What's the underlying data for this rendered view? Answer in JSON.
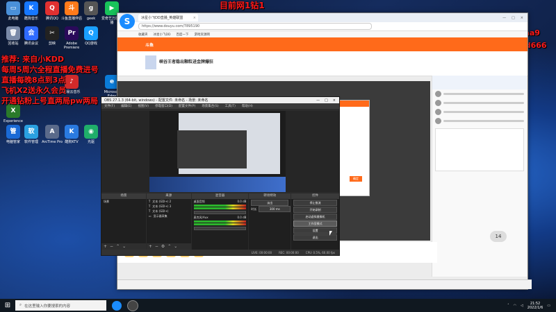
{
  "overlay": {
    "top_text": "目前网1钻1",
    "right_line1": "千分PW V jxyaa9",
    "right_line2": "本人xiaofeidd666",
    "left_lines": [
      "推荐: 来自小KDD",
      "每周5周六全程直播免费进号",
      "直播每晚8点到3点",
      "飞机X2送永久会员",
      "开通钻粉上号直两局pw两局"
    ]
  },
  "desktop_icons": [
    {
      "label": "此电脑",
      "color": "#4a90d9",
      "glyph": "▭"
    },
    {
      "label": "酷狗音乐",
      "color": "#1677ff",
      "glyph": "K"
    },
    {
      "label": "腾讯QQ",
      "color": "#e03030",
      "glyph": "Q"
    },
    {
      "label": "斗鱼直播伴侣",
      "color": "#ff7a1a",
      "glyph": "斗"
    },
    {
      "label": "geek",
      "color": "#555555",
      "glyph": "g"
    },
    {
      "label": "爱奇艺万能联播",
      "color": "#18c25a",
      "glyph": "▶"
    },
    {
      "label": "回收站",
      "color": "#7a8aa8",
      "glyph": "🗑"
    },
    {
      "label": "腾讯会议",
      "color": "#2f6bff",
      "glyph": "会"
    },
    {
      "label": "剪映",
      "color": "#222222",
      "glyph": "✂"
    },
    {
      "label": "Adobe Premiere",
      "color": "#2a0a5a",
      "glyph": "Pr"
    },
    {
      "label": "QQ游戏",
      "color": "#1aa0ff",
      "glyph": "Q"
    },
    {
      "label": "Microsoft Edge",
      "color": "#0a7bd8",
      "glyph": "e"
    },
    {
      "label": "网易云音乐",
      "color": "#d22a2a",
      "glyph": "♪"
    },
    {
      "label": "Experience",
      "color": "#2a7a2a",
      "glyph": "X"
    },
    {
      "label": "电脑管家",
      "color": "#1a6ad6",
      "glyph": "管"
    },
    {
      "label": "软件管理",
      "color": "#2aa0e0",
      "glyph": "软"
    },
    {
      "label": "ArcTime Pro",
      "color": "#5a6a8a",
      "glyph": "A"
    },
    {
      "label": "酷狗KTV",
      "color": "#2a7ae0",
      "glyph": "K"
    },
    {
      "label": "光驱",
      "color": "#1fae6a",
      "glyph": "◉"
    }
  ],
  "browser": {
    "tab_title": "冰星小飞DD直播_英雄联盟",
    "url": "https://www.douyu.com/7895190",
    "favorites": [
      "收藏夹",
      "冰星小飞DD",
      "百度一下",
      "游戏资源网"
    ],
    "page_title": "峡谷王者稳出颗粒进金牌爆狂",
    "site_brand": "斗鱼",
    "dialog_btn": "确定"
  },
  "obs": {
    "title": "OBS 27.1.3 (64-bit, windows) - 配置文件: 未命名 - 场景: 未命名",
    "menu": [
      "文件(F)",
      "编辑(E)",
      "视图(V)",
      "停靠窗口(D)",
      "配置文件(P)",
      "场景集合(S)",
      "工具(T)",
      "帮助(H)"
    ],
    "scene_label": "未选择源",
    "docks": {
      "scenes": {
        "title": "场景",
        "items": [
          "场景"
        ]
      },
      "sources": {
        "title": "来源",
        "items": [
          "文本 (GDI+) 2",
          "文本 (GDI+) 3",
          "文本 (GDI+)",
          "显示器采集"
        ]
      },
      "mixer": {
        "title": "混音器",
        "items": [
          "桌面音频",
          "麦克风/Aux"
        ],
        "levels": [
          "0.0 dB",
          "0.0 dB"
        ]
      },
      "transitions": {
        "title": "转场特效",
        "type": "淡出",
        "duration_label": "时长",
        "duration": "300 ms"
      },
      "controls": {
        "title": "控件",
        "buttons": [
          "停止推流",
          "开始录制",
          "启动虚拟摄像机",
          "工作室模式",
          "设置",
          "退出"
        ]
      }
    },
    "status": [
      "LIVE: 00:00:00",
      "REC: 00:00:00",
      "CPU: 0.5%, 60.00 fps"
    ]
  },
  "page_badge": "14",
  "taskbar": {
    "search_placeholder": "在这里输入你要搜索的内容",
    "time": "21:52",
    "date": "2022/1/6"
  }
}
